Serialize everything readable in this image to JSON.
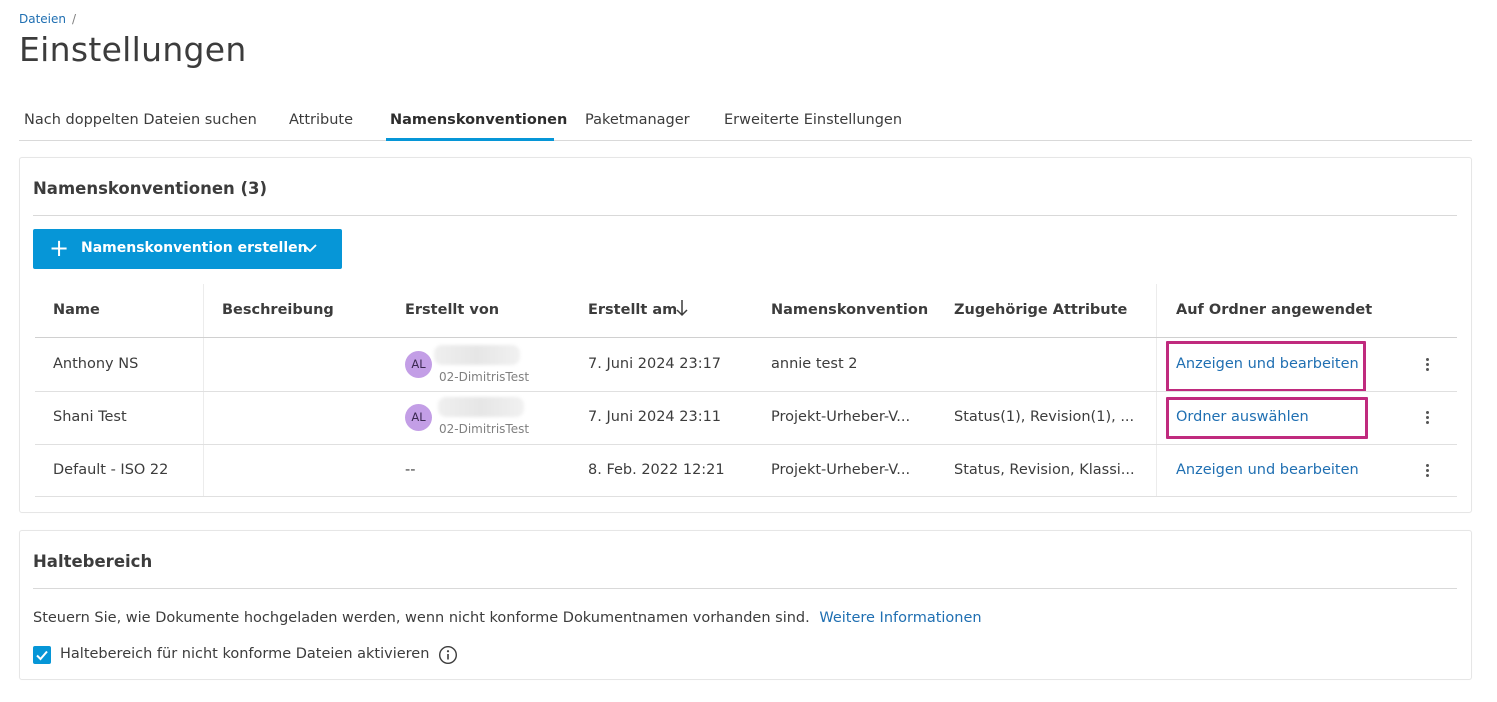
{
  "breadcrumb": {
    "root": "Dateien",
    "separator": "/"
  },
  "page_title": "Einstellungen",
  "tabs": [
    {
      "label": "Nach doppelten Dateien suchen",
      "active": false
    },
    {
      "label": "Attribute",
      "active": false
    },
    {
      "label": "Namenskonventionen",
      "active": true
    },
    {
      "label": "Paketmanager",
      "active": false
    },
    {
      "label": "Erweiterte Einstellungen",
      "active": false
    }
  ],
  "naming_card": {
    "title": "Namenskonventionen (3)",
    "create_button": {
      "label": "Namenskonvention erstellen",
      "icon": "plus-icon",
      "dropdown_icon": "chevron-down-icon"
    },
    "columns": {
      "name": "Name",
      "description": "Beschreibung",
      "created_by": "Erstellt von",
      "created_at": "Erstellt am",
      "convention": "Namenskonvention",
      "attributes": "Zugehörige Attribute",
      "applied_folders": "Auf Ordner angewendet"
    },
    "sort": {
      "column": "created_at",
      "direction": "descending",
      "icon": "arrow-down-icon"
    },
    "rows": [
      {
        "name": "Anthony NS",
        "description": "",
        "avatar_initials": "AL",
        "creator_sub": "02-DimitrisTest",
        "creator_plain": "",
        "created_at": "7. Juni 2024 23:17",
        "convention": "annie test 2",
        "attributes": "",
        "applied": "Anzeigen und bearbeiten",
        "highlighted": true
      },
      {
        "name": "Shani Test",
        "description": "",
        "avatar_initials": "AL",
        "creator_sub": "02-DimitrisTest",
        "creator_plain": "",
        "created_at": "7. Juni 2024 23:11",
        "convention": "Projekt-Urheber-V...",
        "attributes": "Status(1), Revision(1), ...",
        "applied": "Ordner auswählen",
        "highlighted": true
      },
      {
        "name": "Default - ISO 22",
        "description": "",
        "avatar_initials": "",
        "creator_sub": "",
        "creator_plain": "--",
        "created_at": "8. Feb. 2022 12:21",
        "convention": "Projekt-Urheber-V...",
        "attributes": "Status, Revision, Klassi...",
        "applied": "Anzeigen und bearbeiten",
        "highlighted": false
      }
    ]
  },
  "holding_card": {
    "title": "Haltebereich",
    "description": "Steuern Sie, wie Dokumente hochgeladen werden, wenn nicht konforme Dokumentnamen vorhanden sind.",
    "more_info_link": "Weitere Informationen",
    "checkbox": {
      "label": "Haltebereich für nicht konforme Dateien aktivieren",
      "checked": true
    }
  },
  "colors": {
    "accent": "#0696d7",
    "link": "#1f6fb2",
    "highlight": "#c02a7e",
    "avatar": "#c39ee6"
  }
}
